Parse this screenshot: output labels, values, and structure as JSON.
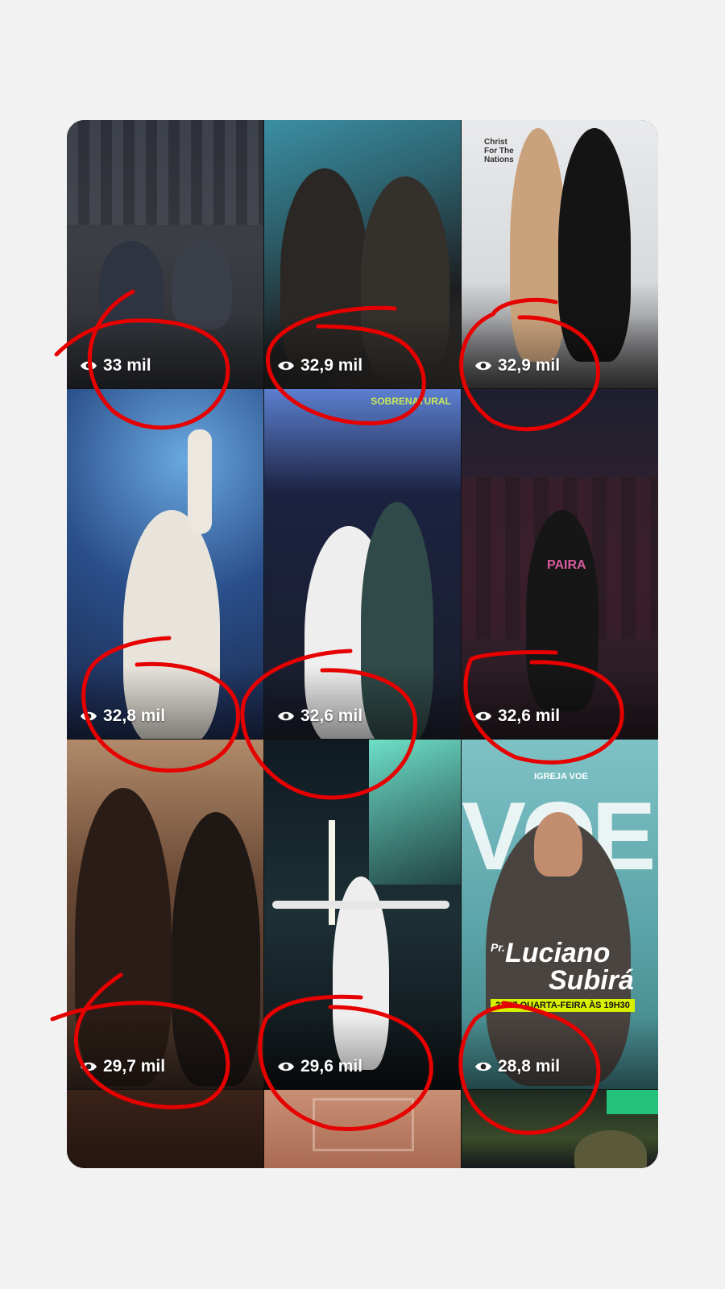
{
  "tiles": [
    {
      "views": "33 mil"
    },
    {
      "views": "32,9 mil"
    },
    {
      "views": "32,9 mil"
    },
    {
      "views": "32,8 mil"
    },
    {
      "views": "32,6 mil"
    },
    {
      "views": "32,6 mil"
    },
    {
      "views": "29,7 mil"
    },
    {
      "views": "29,6 mil"
    },
    {
      "views": "28,8 mil"
    }
  ],
  "poster": {
    "brand": "IGREJA VOE",
    "big_word": "VOE",
    "prefix": "Pr.",
    "first_name": "Luciano",
    "last_name": "Subirá",
    "date_line": "22/07 QUARTA-FEIRA ÀS 19H30"
  },
  "backdrop_text": "Christ For The Nations",
  "shirt_text": "PAIRA",
  "banner_text": "SOBRENATURAL",
  "colors": {
    "page_bg": "#f2f2f2",
    "annotation_red": "#e60000",
    "overlay_text": "#ffffff",
    "poster_accent": "#d8f000"
  }
}
